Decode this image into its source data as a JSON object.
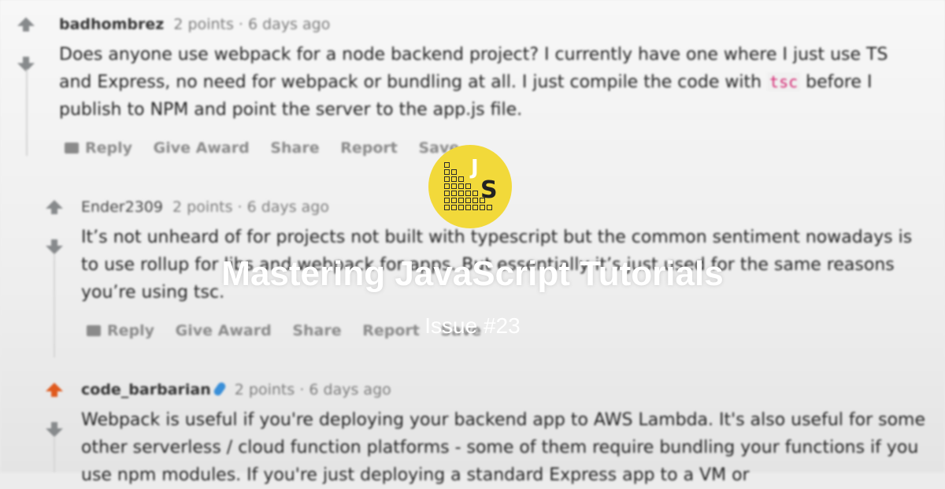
{
  "comments": [
    {
      "author": "badhombrez",
      "points": "2 points",
      "age": "· 6 days ago",
      "body_before": "Does anyone use webpack for a node backend project? I currently have one where I just use TS and Express, no need for webpack or bundling at all. I just compile the code with ",
      "code": "tsc",
      "body_after": " before I publish to NPM and point the server to the app.js file.",
      "actions": [
        "Reply",
        "Give Award",
        "Share",
        "Report",
        "Save"
      ]
    },
    {
      "author": "Ender2309",
      "points": "2 points",
      "age": "· 6 days ago",
      "body": "It’s not unheard of for projects not built with typescript but the common sentiment nowadays is to use rollup for libs and webpack for apps. But essentially it’s just used for the same reasons you’re using tsc.",
      "actions": [
        "Reply",
        "Give Award",
        "Share",
        "Report",
        "Save"
      ]
    },
    {
      "author": "code_barbarian",
      "points": "2 points",
      "age": "· 6 days ago",
      "body": "Webpack is useful if you're deploying your backend app to AWS Lambda. It's also useful for some other serverless / cloud function platforms - some of them require bundling your functions if you use npm modules. If you're just deploying a standard Express app to a VM or"
    }
  ],
  "overlay": {
    "logo_j": "J",
    "logo_s": "S",
    "title": "Mastering JavaScript Tutorials",
    "subtitle": "Issue #23"
  },
  "colors": {
    "logo": "#f2d93a",
    "upvote_active": "#e05a1e",
    "code": "#d4236f"
  }
}
